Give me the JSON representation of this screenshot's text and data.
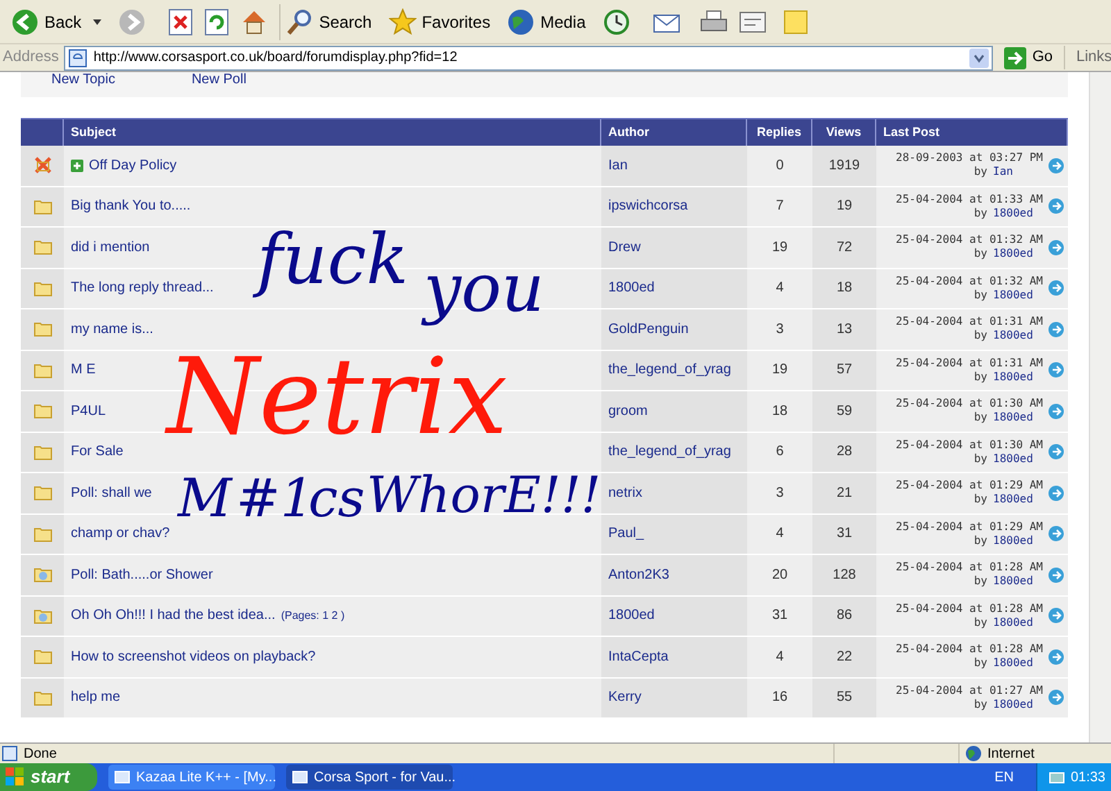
{
  "toolbar": {
    "back": "Back",
    "search": "Search",
    "favorites": "Favorites",
    "media": "Media"
  },
  "address_bar": {
    "label": "Address",
    "url": "http://www.corsasport.co.uk/board/forumdisplay.php?fid=12",
    "go": "Go",
    "links": "Links"
  },
  "forum_links": [
    "New Topic",
    "New Poll"
  ],
  "table": {
    "columns": [
      "Subject",
      "Author",
      "Replies",
      "Views",
      "Last Post"
    ],
    "rows": [
      {
        "kind": "locked",
        "sticky": true,
        "subject": "Off Day Policy",
        "author": "Ian",
        "replies": "0",
        "views": "1919",
        "date": "28-09-2003 at 03:27 PM",
        "by": "by",
        "last_by": "Ian"
      },
      {
        "kind": "normal",
        "sticky": false,
        "subject": "Big thank You to.....",
        "author": "ipswichcorsa",
        "replies": "7",
        "views": "19",
        "date": "25-04-2004 at 01:33 AM",
        "by": "by",
        "last_by": "1800ed"
      },
      {
        "kind": "normal",
        "sticky": false,
        "subject": "did i mention",
        "author": "Drew",
        "replies": "19",
        "views": "72",
        "date": "25-04-2004 at 01:32 AM",
        "by": "by",
        "last_by": "1800ed"
      },
      {
        "kind": "normal",
        "sticky": false,
        "subject": "The long reply thread...",
        "author": "1800ed",
        "replies": "4",
        "views": "18",
        "date": "25-04-2004 at 01:32 AM",
        "by": "by",
        "last_by": "1800ed"
      },
      {
        "kind": "normal",
        "sticky": false,
        "subject": "my name is...",
        "author": "GoldPenguin",
        "replies": "3",
        "views": "13",
        "date": "25-04-2004 at 01:31 AM",
        "by": "by",
        "last_by": "1800ed"
      },
      {
        "kind": "normal",
        "sticky": false,
        "subject": "M E",
        "author": "the_legend_of_yrag",
        "replies": "19",
        "views": "57",
        "date": "25-04-2004 at 01:31 AM",
        "by": "by",
        "last_by": "1800ed"
      },
      {
        "kind": "normal",
        "sticky": false,
        "subject": "P4UL",
        "author": "groom",
        "replies": "18",
        "views": "59",
        "date": "25-04-2004 at 01:30 AM",
        "by": "by",
        "last_by": "1800ed"
      },
      {
        "kind": "normal",
        "sticky": false,
        "subject": "For Sale",
        "author": "the_legend_of_yrag",
        "replies": "6",
        "views": "28",
        "date": "25-04-2004 at 01:30 AM",
        "by": "by",
        "last_by": "1800ed"
      },
      {
        "kind": "normal",
        "sticky": false,
        "subject": "Poll: shall we",
        "author": "netrix",
        "replies": "3",
        "views": "21",
        "date": "25-04-2004 at 01:29 AM",
        "by": "by",
        "last_by": "1800ed"
      },
      {
        "kind": "normal",
        "sticky": false,
        "subject": "champ or chav?",
        "author": "Paul_",
        "replies": "4",
        "views": "31",
        "date": "25-04-2004 at 01:29 AM",
        "by": "by",
        "last_by": "1800ed"
      },
      {
        "kind": "hot",
        "sticky": false,
        "subject": "Poll: Bath.....or Shower",
        "author": "Anton2K3",
        "replies": "20",
        "views": "128",
        "date": "25-04-2004 at 01:28 AM",
        "by": "by",
        "last_by": "1800ed"
      },
      {
        "kind": "hot",
        "sticky": false,
        "subject": "Oh Oh Oh!!! I had the best idea...",
        "pages": "(Pages: 1 2 )",
        "author": "1800ed",
        "replies": "31",
        "views": "86",
        "date": "25-04-2004 at 01:28 AM",
        "by": "by",
        "last_by": "1800ed"
      },
      {
        "kind": "normal",
        "sticky": false,
        "subject": "How to screenshot videos on playback?",
        "author": "IntaCepta",
        "replies": "4",
        "views": "22",
        "date": "25-04-2004 at 01:28 AM",
        "by": "by",
        "last_by": "1800ed"
      },
      {
        "kind": "normal",
        "sticky": false,
        "subject": "help me",
        "author": "Kerry",
        "replies": "16",
        "views": "55",
        "date": "25-04-2004 at 01:27 AM",
        "by": "by",
        "last_by": "1800ed"
      }
    ]
  },
  "scrawl": [
    {
      "text": "fuck",
      "color": "#0a0a8c"
    },
    {
      "text": "you",
      "color": "#0a0a8c"
    },
    {
      "text": "Netrix",
      "color": "#ff1a0a"
    },
    {
      "text": "M",
      "color": "#0a0a8c"
    },
    {
      "text": "#1",
      "color": "#0a0a8c"
    },
    {
      "text": "cs",
      "color": "#0a0a8c"
    },
    {
      "text": "WhorE!!!",
      "color": "#0a0a8c"
    }
  ],
  "status_bar": {
    "status": "Done",
    "zone": "Internet"
  },
  "taskbar": {
    "start": "start",
    "tasks": [
      {
        "label": "Kazaa Lite K++ - [My...",
        "selected": false
      },
      {
        "label": "Corsa Sport - for Vau...",
        "selected": true
      }
    ],
    "language": "EN",
    "clock": "01:33"
  }
}
